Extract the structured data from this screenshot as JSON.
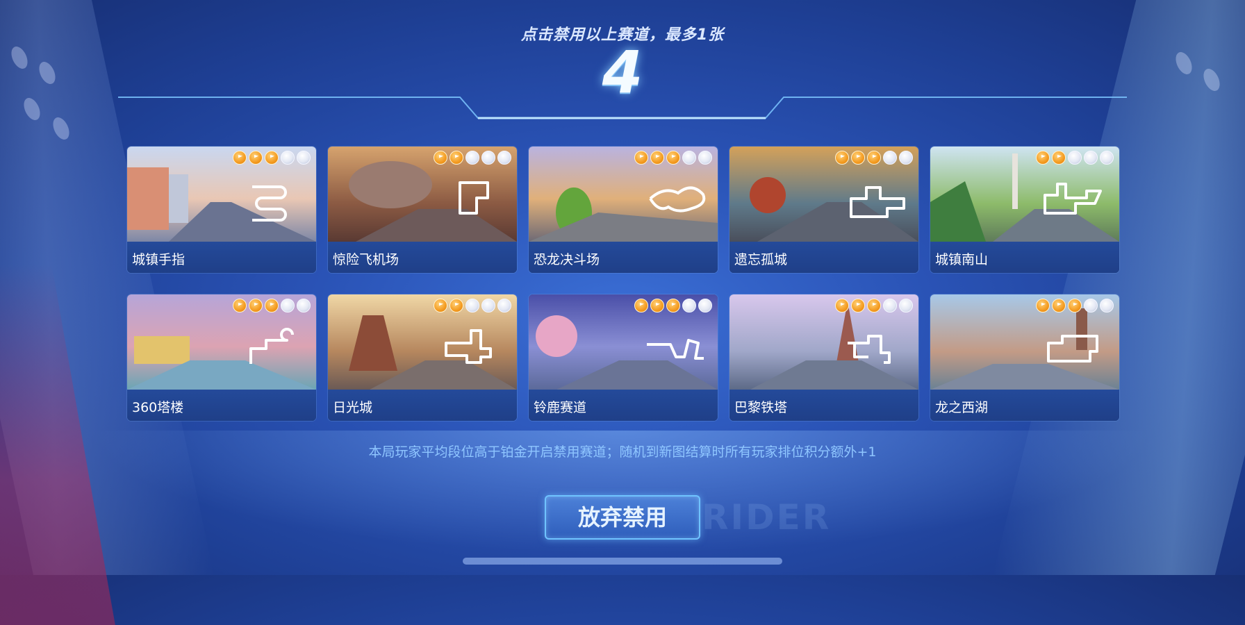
{
  "header": {
    "instruction": "点击禁用以上赛道，最多1张",
    "countdown": "4"
  },
  "tracks": [
    {
      "name": "城镇手指",
      "difficulty": 3,
      "max_difficulty": 5
    },
    {
      "name": "惊险飞机场",
      "difficulty": 2,
      "max_difficulty": 5
    },
    {
      "name": "恐龙决斗场",
      "difficulty": 3,
      "max_difficulty": 5
    },
    {
      "name": "遗忘孤城",
      "difficulty": 3,
      "max_difficulty": 5
    },
    {
      "name": "城镇南山",
      "difficulty": 2,
      "max_difficulty": 5
    },
    {
      "name": "360塔楼",
      "difficulty": 3,
      "max_difficulty": 5
    },
    {
      "name": "日光城",
      "difficulty": 2,
      "max_difficulty": 5
    },
    {
      "name": "铃鹿赛道",
      "difficulty": 3,
      "max_difficulty": 5
    },
    {
      "name": "巴黎铁塔",
      "difficulty": 3,
      "max_difficulty": 5
    },
    {
      "name": "龙之西湖",
      "difficulty": 3,
      "max_difficulty": 5
    }
  ],
  "notice": "本局玩家平均段位高于铂金开启禁用赛道；随机到新图结算时所有玩家排位积分额外+1",
  "buttons": {
    "abandon_label": "放弃禁用"
  },
  "watermark": "RIDER",
  "colors": {
    "accent": "#6fc3ff",
    "difficulty_on": "#f49b20",
    "difficulty_off": "#e4e8f4"
  }
}
